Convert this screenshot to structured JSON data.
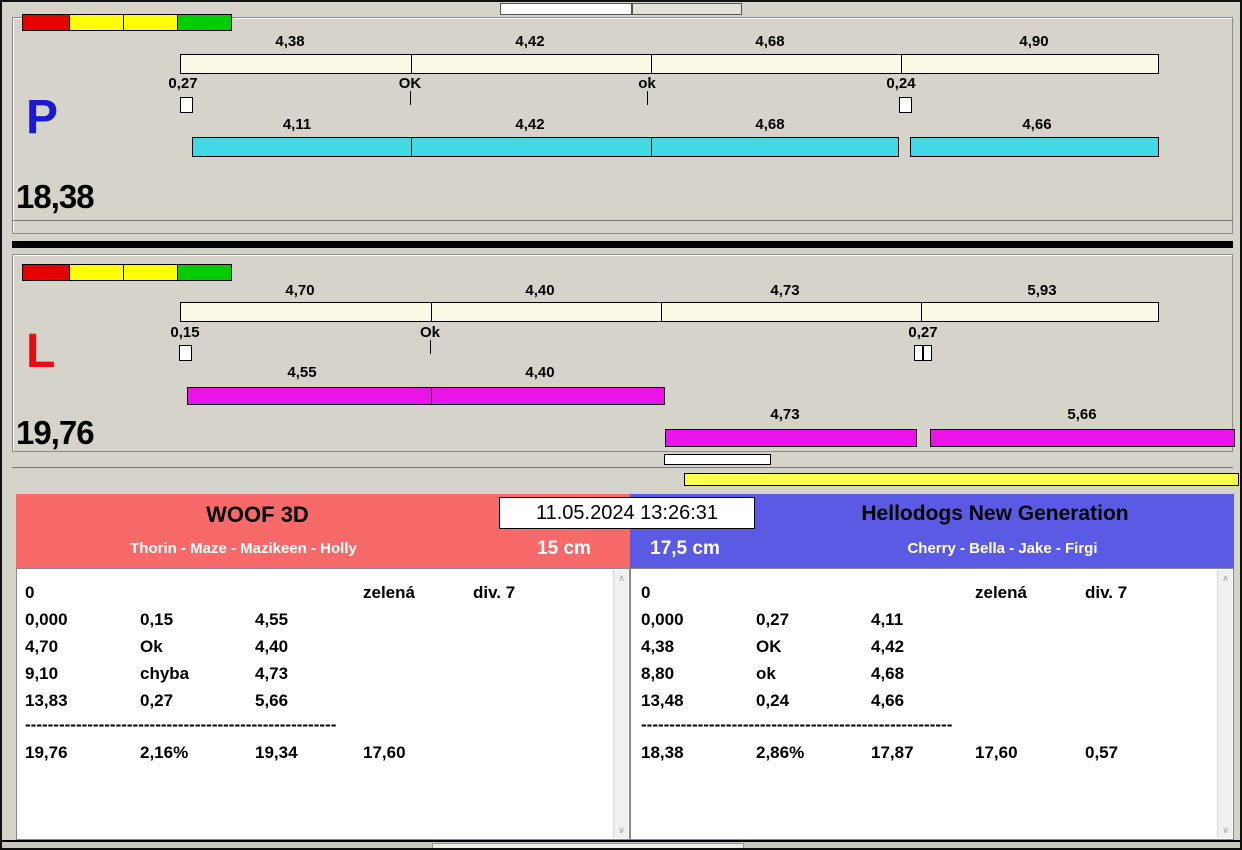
{
  "colors": {
    "cyan": "#41d9e6",
    "magenta": "#ea14ea",
    "cream": "#fbf8e6",
    "legend-red": "#e60000",
    "legend-yellow": "#ffff00",
    "legend-green": "#00cc00",
    "header-red": "#f86a6a",
    "header-blue": "#5a5ae4",
    "yellow-bar": "#ffff4d",
    "p-blue": "#1a1acc",
    "l-red": "#e01010"
  },
  "icons": {
    "scroll_up": "∧",
    "scroll_down": "∨"
  },
  "track_p": {
    "letter": "P",
    "total": "18,38",
    "ref_bar_labels": [
      "4,38",
      "4,42",
      "4,68",
      "4,90"
    ],
    "markers": [
      "0,27",
      "OK",
      "ok",
      "0,24"
    ],
    "run_bar_labels": [
      "4,11",
      "4,42",
      "4,68",
      "4,66"
    ]
  },
  "track_l": {
    "letter": "L",
    "total": "19,76",
    "ref_bar_labels": [
      "4,70",
      "4,40",
      "4,73",
      "5,93"
    ],
    "markers": [
      "0,15",
      "Ok",
      "0,27"
    ],
    "run_bar_labels_row1": [
      "4,55",
      "4,40"
    ],
    "run_bar_labels_row2": [
      "4,73",
      "5,66"
    ]
  },
  "datetime": "11.05.2024 13:26:31",
  "left_team": {
    "title": "WOOF 3D",
    "dogs": "Thorin - Maze - Mazikeen - Holly",
    "height": "15 cm",
    "rows": [
      [
        "0",
        "",
        "",
        "zelená",
        "div. 7"
      ],
      [
        "0,000",
        "0,15",
        "4,55",
        "",
        ""
      ],
      [
        "4,70",
        "Ok",
        "4,40",
        "",
        ""
      ],
      [
        "9,10",
        "chyba",
        "4,73",
        "",
        ""
      ],
      [
        "13,83",
        "0,27",
        "5,66",
        "",
        ""
      ]
    ],
    "dashes": "-------------------------------------------------------",
    "totals": [
      "19,76",
      "2,16%",
      "19,34",
      "17,60",
      ""
    ]
  },
  "right_team": {
    "title": "Hellodogs New Generation",
    "dogs": "Cherry - Bella - Jake - Firgi",
    "height": "17,5 cm",
    "rows": [
      [
        "0",
        "",
        "",
        "zelená",
        "div. 7"
      ],
      [
        "0,000",
        "0,27",
        "4,11",
        "",
        ""
      ],
      [
        "4,38",
        "OK",
        "4,42",
        "",
        ""
      ],
      [
        "8,80",
        "ok",
        "4,68",
        "",
        ""
      ],
      [
        "13,48",
        "0,24",
        "4,66",
        "",
        ""
      ]
    ],
    "dashes": "-------------------------------------------------------",
    "totals": [
      "18,38",
      "2,86%",
      "17,87",
      "17,60",
      "0,57"
    ]
  }
}
